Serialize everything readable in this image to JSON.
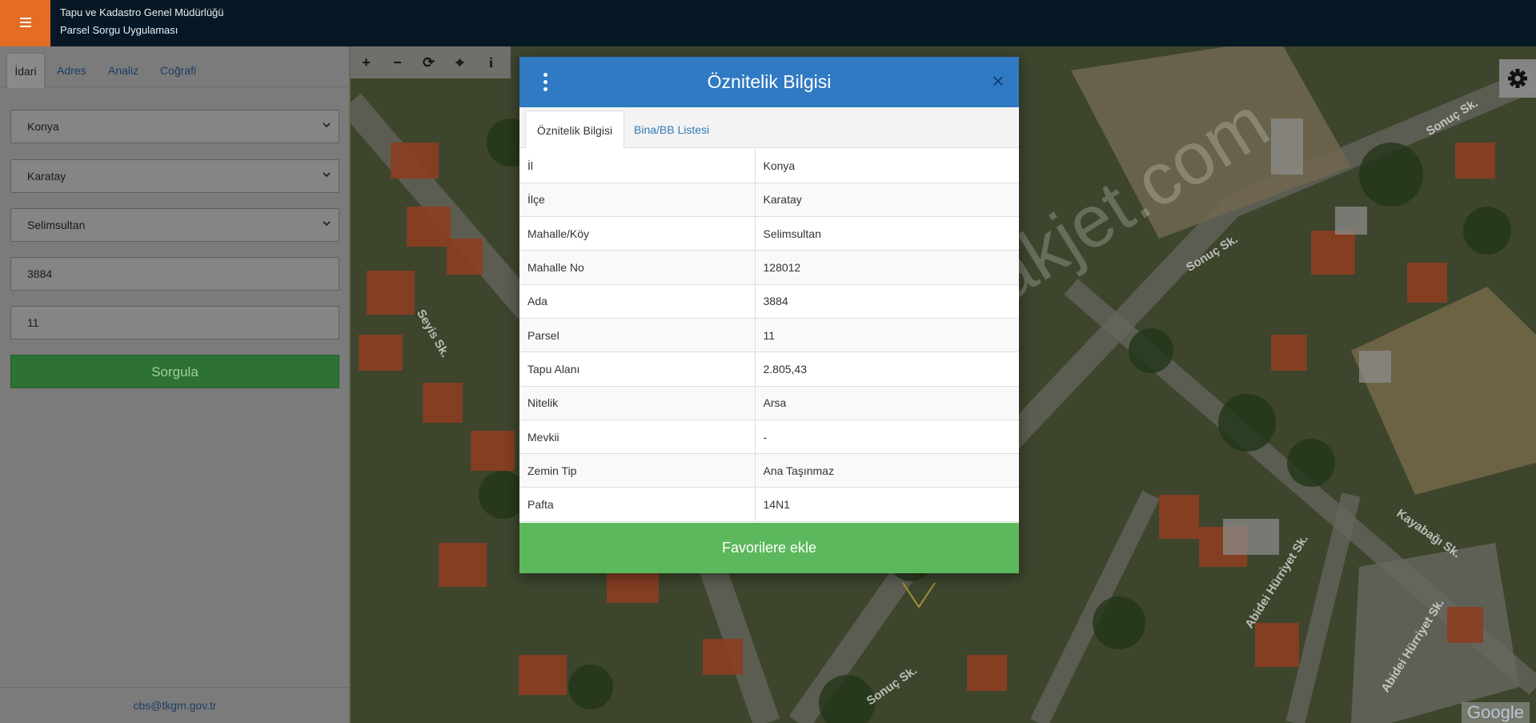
{
  "header": {
    "title_line1": "Tapu ve Kadastro Genel Müdürlüğü",
    "title_line2": "Parsel Sorgu Uygulaması",
    "menu_icon": "hamburger-icon",
    "accent_color": "#e46c24"
  },
  "sidebar": {
    "tabs": [
      {
        "label": "İdari",
        "active": true
      },
      {
        "label": "Adres",
        "active": false
      },
      {
        "label": "Analiz",
        "active": false
      },
      {
        "label": "Coğrafi",
        "active": false
      }
    ],
    "fields": {
      "il": "Konya",
      "ilce": "Karatay",
      "mahalle": "Selimsultan",
      "ada": "3884",
      "parsel": "11"
    },
    "submit_label": "Sorgula",
    "footer_email": "cbs@tkgm.gov.tr"
  },
  "map": {
    "toolbar_icons": [
      "zoom-in-icon",
      "zoom-out-icon",
      "refresh-icon",
      "locate-icon",
      "info-icon"
    ],
    "toolbar_glyphs": [
      "+",
      "−",
      "⟳",
      "⌖",
      "i"
    ],
    "settings_icon": "gear-icon",
    "watermark": "emlakjet.com",
    "attribution": "Google",
    "streets": [
      "Sonuç Sk.",
      "Sonuç Sk.",
      "Sonuç Sk.",
      "Seyis Sk.",
      "Kayabağı Sk.",
      "Abidei Hürriyet Sk.",
      "Abidei Hürriyet Sk."
    ]
  },
  "modal": {
    "title": "Öznitelik Bilgisi",
    "close_glyph": "×",
    "tabs": [
      {
        "label": "Öznitelik Bilgisi",
        "active": true
      },
      {
        "label": "Bina/BB Listesi",
        "active": false
      }
    ],
    "rows": [
      {
        "key": "İl",
        "value": "Konya"
      },
      {
        "key": "İlçe",
        "value": "Karatay"
      },
      {
        "key": "Mahalle/Köy",
        "value": "Selimsultan"
      },
      {
        "key": "Mahalle No",
        "value": "128012"
      },
      {
        "key": "Ada",
        "value": "3884"
      },
      {
        "key": "Parsel",
        "value": "11"
      },
      {
        "key": "Tapu Alanı",
        "value": "2.805,43"
      },
      {
        "key": "Nitelik",
        "value": "Arsa"
      },
      {
        "key": "Mevkii",
        "value": "-"
      },
      {
        "key": "Zemin Tip",
        "value": "Ana Taşınmaz"
      },
      {
        "key": "Pafta",
        "value": "14N1"
      }
    ],
    "favorite_label": "Favorilere ekle",
    "header_color": "#2f7ac2",
    "favorite_color": "#5cb85c"
  }
}
